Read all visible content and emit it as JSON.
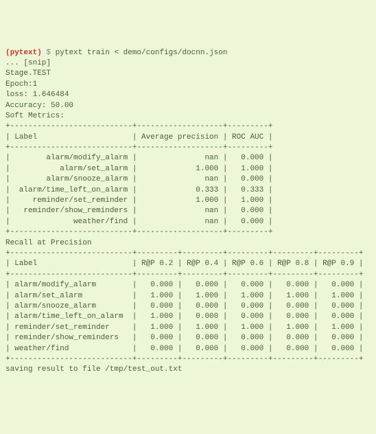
{
  "prompt": {
    "env": "(pytext)",
    "symbol": "$",
    "command": "pytext train < demo/configs/docnn.json"
  },
  "snip": "... [snip]",
  "stage": "Stage.TEST",
  "epoch": "Epoch:1",
  "loss": "loss: 1.646484",
  "accuracy": "Accuracy: 50.00",
  "soft_metrics_title": "Soft Metrics:",
  "soft_metrics_header": {
    "label": "Label",
    "avg_precision": "Average precision",
    "roc_auc": "ROC AUC"
  },
  "soft_metrics_rows": [
    {
      "label": "alarm/modify_alarm",
      "avg_precision": "nan",
      "roc_auc": "0.000"
    },
    {
      "label": "alarm/set_alarm",
      "avg_precision": "1.000",
      "roc_auc": "1.000"
    },
    {
      "label": "alarm/snooze_alarm",
      "avg_precision": "nan",
      "roc_auc": "0.000"
    },
    {
      "label": "alarm/time_left_on_alarm",
      "avg_precision": "0.333",
      "roc_auc": "0.333"
    },
    {
      "label": "reminder/set_reminder",
      "avg_precision": "1.000",
      "roc_auc": "1.000"
    },
    {
      "label": "reminder/show_reminders",
      "avg_precision": "nan",
      "roc_auc": "0.000"
    },
    {
      "label": "weather/find",
      "avg_precision": "nan",
      "roc_auc": "0.000"
    }
  ],
  "recall_title": "Recall at Precision",
  "recall_header": {
    "label": "Label",
    "c1": "R@P 0.2",
    "c2": "R@P 0.4",
    "c3": "R@P 0.6",
    "c4": "R@P 0.8",
    "c5": "R@P 0.9"
  },
  "recall_rows": [
    {
      "label": "alarm/modify_alarm",
      "v": [
        "0.000",
        "0.000",
        "0.000",
        "0.000",
        "0.000"
      ]
    },
    {
      "label": "alarm/set_alarm",
      "v": [
        "1.000",
        "1.000",
        "1.000",
        "1.000",
        "1.000"
      ]
    },
    {
      "label": "alarm/snooze_alarm",
      "v": [
        "0.000",
        "0.000",
        "0.000",
        "0.000",
        "0.000"
      ]
    },
    {
      "label": "alarm/time_left_on_alarm",
      "v": [
        "1.000",
        "0.000",
        "0.000",
        "0.000",
        "0.000"
      ]
    },
    {
      "label": "reminder/set_reminder",
      "v": [
        "1.000",
        "1.000",
        "1.000",
        "1.000",
        "1.000"
      ]
    },
    {
      "label": "reminder/show_reminders",
      "v": [
        "0.000",
        "0.000",
        "0.000",
        "0.000",
        "0.000"
      ]
    },
    {
      "label": "weather/find",
      "v": [
        "0.000",
        "0.000",
        "0.000",
        "0.000",
        "0.000"
      ]
    }
  ],
  "save_line": "saving result to file /tmp/test_out.txt",
  "chart_data": [
    {
      "type": "table",
      "title": "Soft Metrics",
      "columns": [
        "Label",
        "Average precision",
        "ROC AUC"
      ],
      "rows": [
        [
          "alarm/modify_alarm",
          "nan",
          0.0
        ],
        [
          "alarm/set_alarm",
          1.0,
          1.0
        ],
        [
          "alarm/snooze_alarm",
          "nan",
          0.0
        ],
        [
          "alarm/time_left_on_alarm",
          0.333,
          0.333
        ],
        [
          "reminder/set_reminder",
          1.0,
          1.0
        ],
        [
          "reminder/show_reminders",
          "nan",
          0.0
        ],
        [
          "weather/find",
          "nan",
          0.0
        ]
      ]
    },
    {
      "type": "table",
      "title": "Recall at Precision",
      "columns": [
        "Label",
        "R@P 0.2",
        "R@P 0.4",
        "R@P 0.6",
        "R@P 0.8",
        "R@P 0.9"
      ],
      "rows": [
        [
          "alarm/modify_alarm",
          0.0,
          0.0,
          0.0,
          0.0,
          0.0
        ],
        [
          "alarm/set_alarm",
          1.0,
          1.0,
          1.0,
          1.0,
          1.0
        ],
        [
          "alarm/snooze_alarm",
          0.0,
          0.0,
          0.0,
          0.0,
          0.0
        ],
        [
          "alarm/time_left_on_alarm",
          1.0,
          0.0,
          0.0,
          0.0,
          0.0
        ],
        [
          "reminder/set_reminder",
          1.0,
          1.0,
          1.0,
          1.0,
          1.0
        ],
        [
          "reminder/show_reminders",
          0.0,
          0.0,
          0.0,
          0.0,
          0.0
        ],
        [
          "weather/find",
          0.0,
          0.0,
          0.0,
          0.0,
          0.0
        ]
      ]
    }
  ]
}
